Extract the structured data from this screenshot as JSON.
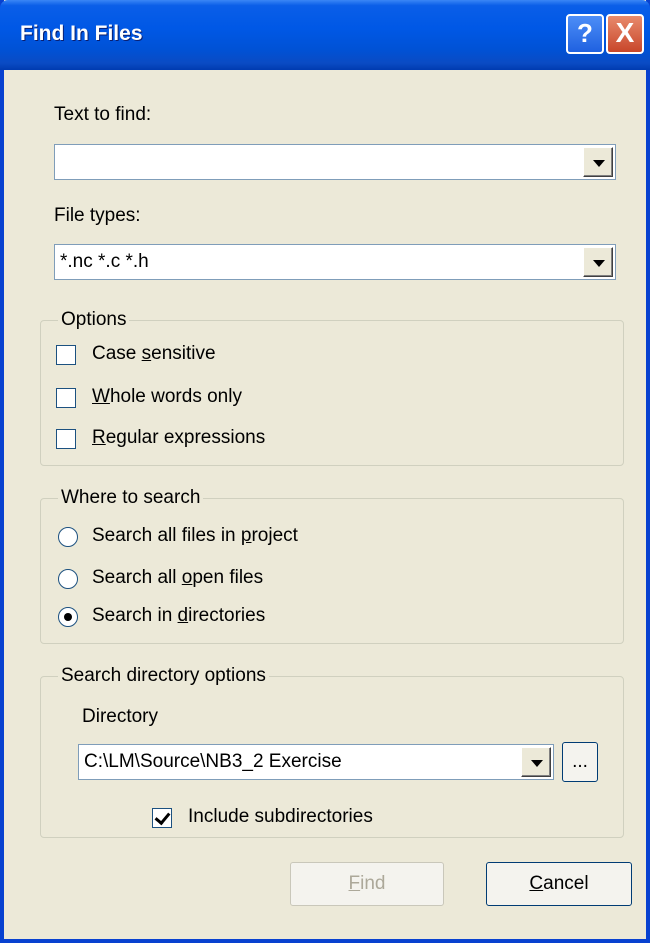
{
  "window": {
    "title": "Find In Files",
    "help_glyph": "?",
    "close_glyph": "X"
  },
  "text_to_find": {
    "label": "Text to find:",
    "value": ""
  },
  "file_types": {
    "label": "File types:",
    "value": "*.nc *.c *.h"
  },
  "options": {
    "legend": "Options",
    "case_sensitive": {
      "pre": "Case ",
      "u": "s",
      "post": "ensitive",
      "checked": false
    },
    "whole_words": {
      "pre": "",
      "u": "W",
      "post": "hole words only",
      "checked": false
    },
    "regular_expressions": {
      "pre": "",
      "u": "R",
      "post": "egular expressions",
      "checked": false
    }
  },
  "where": {
    "legend": "Where to search",
    "project": {
      "pre": "Search all files in ",
      "u": "p",
      "post": "roject",
      "selected": false
    },
    "open_files": {
      "pre": "Search all ",
      "u": "o",
      "post": "pen files",
      "selected": false
    },
    "directories": {
      "pre": "Search in ",
      "u": "d",
      "post": "irectories",
      "selected": true
    }
  },
  "dir_options": {
    "legend": "Search directory options",
    "directory_label": "Directory",
    "directory_value": "C:\\LM\\Source\\NB3_2 Exercise",
    "browse_label": "...",
    "include_subdirs_label": "Include subdirectories",
    "include_subdirs_checked": true
  },
  "buttons": {
    "find": {
      "u": "F",
      "post": "ind"
    },
    "cancel": {
      "u": "C",
      "post": "ancel"
    }
  },
  "colors": {
    "titlebar": "#0058e6",
    "dialog_bg": "#ece9d8",
    "disabled_text": "#aca899"
  }
}
